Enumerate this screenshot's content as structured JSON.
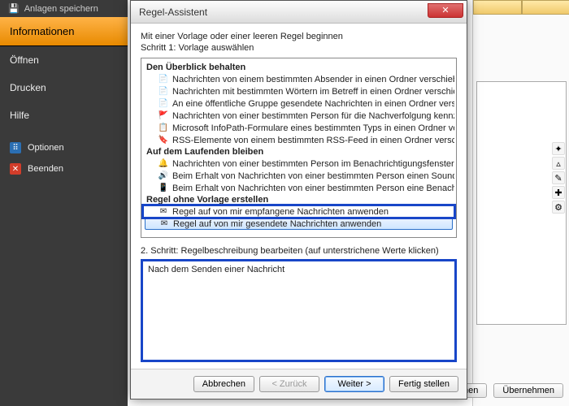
{
  "sidebar": {
    "top": "Anlagen speichern",
    "active": "Informationen",
    "items": [
      "Öffnen",
      "Drucken",
      "Hilfe"
    ],
    "subs": [
      {
        "icon": "grid",
        "label": "Optionen"
      },
      {
        "icon": "x",
        "label": "Beenden"
      }
    ]
  },
  "right": {
    "buttons": {
      "cancel": "brechen",
      "apply": "Übernehmen"
    }
  },
  "dialog": {
    "title": "Regel-Assistent",
    "intro1": "Mit einer Vorlage oder einer leeren Regel beginnen",
    "intro2": "Schritt 1: Vorlage auswählen",
    "categories": [
      {
        "label": "Den Überblick behalten",
        "templates": [
          {
            "icon": "📄",
            "label": "Nachrichten von einem bestimmten Absender in einen Ordner verschieben"
          },
          {
            "icon": "📄",
            "label": "Nachrichten mit bestimmten Wörtern im Betreff in einen Ordner verschieben"
          },
          {
            "icon": "📄",
            "label": "An eine öffentliche Gruppe gesendete Nachrichten in einen Ordner verschieben"
          },
          {
            "icon": "🚩",
            "label": "Nachrichten von einer bestimmten Person für die Nachverfolgung kennzeichnen"
          },
          {
            "icon": "📋",
            "label": "Microsoft InfoPath-Formulare eines bestimmten Typs in einen Ordner verschieben"
          },
          {
            "icon": "🔖",
            "label": "RSS-Elemente von einem bestimmten RSS-Feed in einen Ordner verschieben"
          }
        ]
      },
      {
        "label": "Auf dem Laufenden bleiben",
        "templates": [
          {
            "icon": "🔔",
            "label": "Nachrichten von einer bestimmten Person im Benachrichtigungsfenster für neue Elemente anzeigen"
          },
          {
            "icon": "🔊",
            "label": "Beim Erhalt von Nachrichten von einer bestimmten Person einen Sound wiedergeben"
          },
          {
            "icon": "📱",
            "label": "Beim Erhalt von Nachrichten von einer bestimmten Person eine Benachrichtigung senden"
          }
        ]
      },
      {
        "label": "Regel ohne Vorlage erstellen",
        "templates": [
          {
            "icon": "✉",
            "label": "Regel auf von mir empfangene Nachrichten anwenden",
            "boxed": true
          },
          {
            "icon": "✉",
            "label": "Regel auf von mir gesendete Nachrichten anwenden",
            "selected": true
          }
        ]
      }
    ],
    "step2label": "2. Schritt: Regelbeschreibung bearbeiten (auf unterstrichene Werte klicken)",
    "description": "Nach dem Senden einer Nachricht",
    "buttons": {
      "cancel": "Abbrechen",
      "back": "< Zurück",
      "next": "Weiter >",
      "finish": "Fertig stellen"
    }
  }
}
